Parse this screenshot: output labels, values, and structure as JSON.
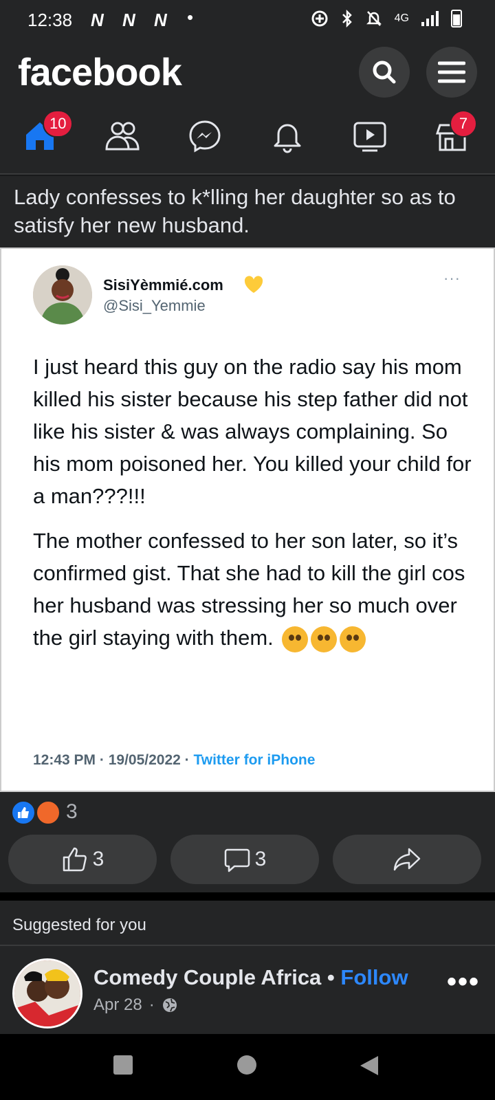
{
  "status_bar": {
    "time": "12:38",
    "notif_icons": "N N N",
    "network": "4G"
  },
  "header": {
    "logo": "facebook"
  },
  "nav": {
    "home_badge": "10",
    "marketplace_badge": "7"
  },
  "post": {
    "title": "Lady confesses to k*lling her daughter so as to satisfy her new husband.",
    "tweet": {
      "name": "SisiYèmmié.com",
      "handle": "@Sisi_Yemmie",
      "more": "···",
      "paragraph1": "I just heard this guy on the radio say his mom killed his sister because his step father did not like his sister & was always complaining. So his mom poisoned her. You killed your child for a man???!!!",
      "paragraph2": "The mother confessed to her son later, so it’s confirmed gist. That she had to kill the girl cos her husband was stressing her so much over the girl staying with them.",
      "time": "12:43 PM · 19/05/2022 · ",
      "source": "Twitter for iPhone"
    },
    "reaction_count": "3",
    "like_count": "3",
    "comment_count": "3"
  },
  "suggested": {
    "label": "Suggested for you",
    "page_name": "Comedy Couple Africa",
    "separator": " • ",
    "follow": "Follow",
    "date": "Apr 28",
    "date_sep": "·"
  },
  "colors": {
    "accent": "#1877f2",
    "badge": "#e41e3f",
    "background": "#242526"
  }
}
